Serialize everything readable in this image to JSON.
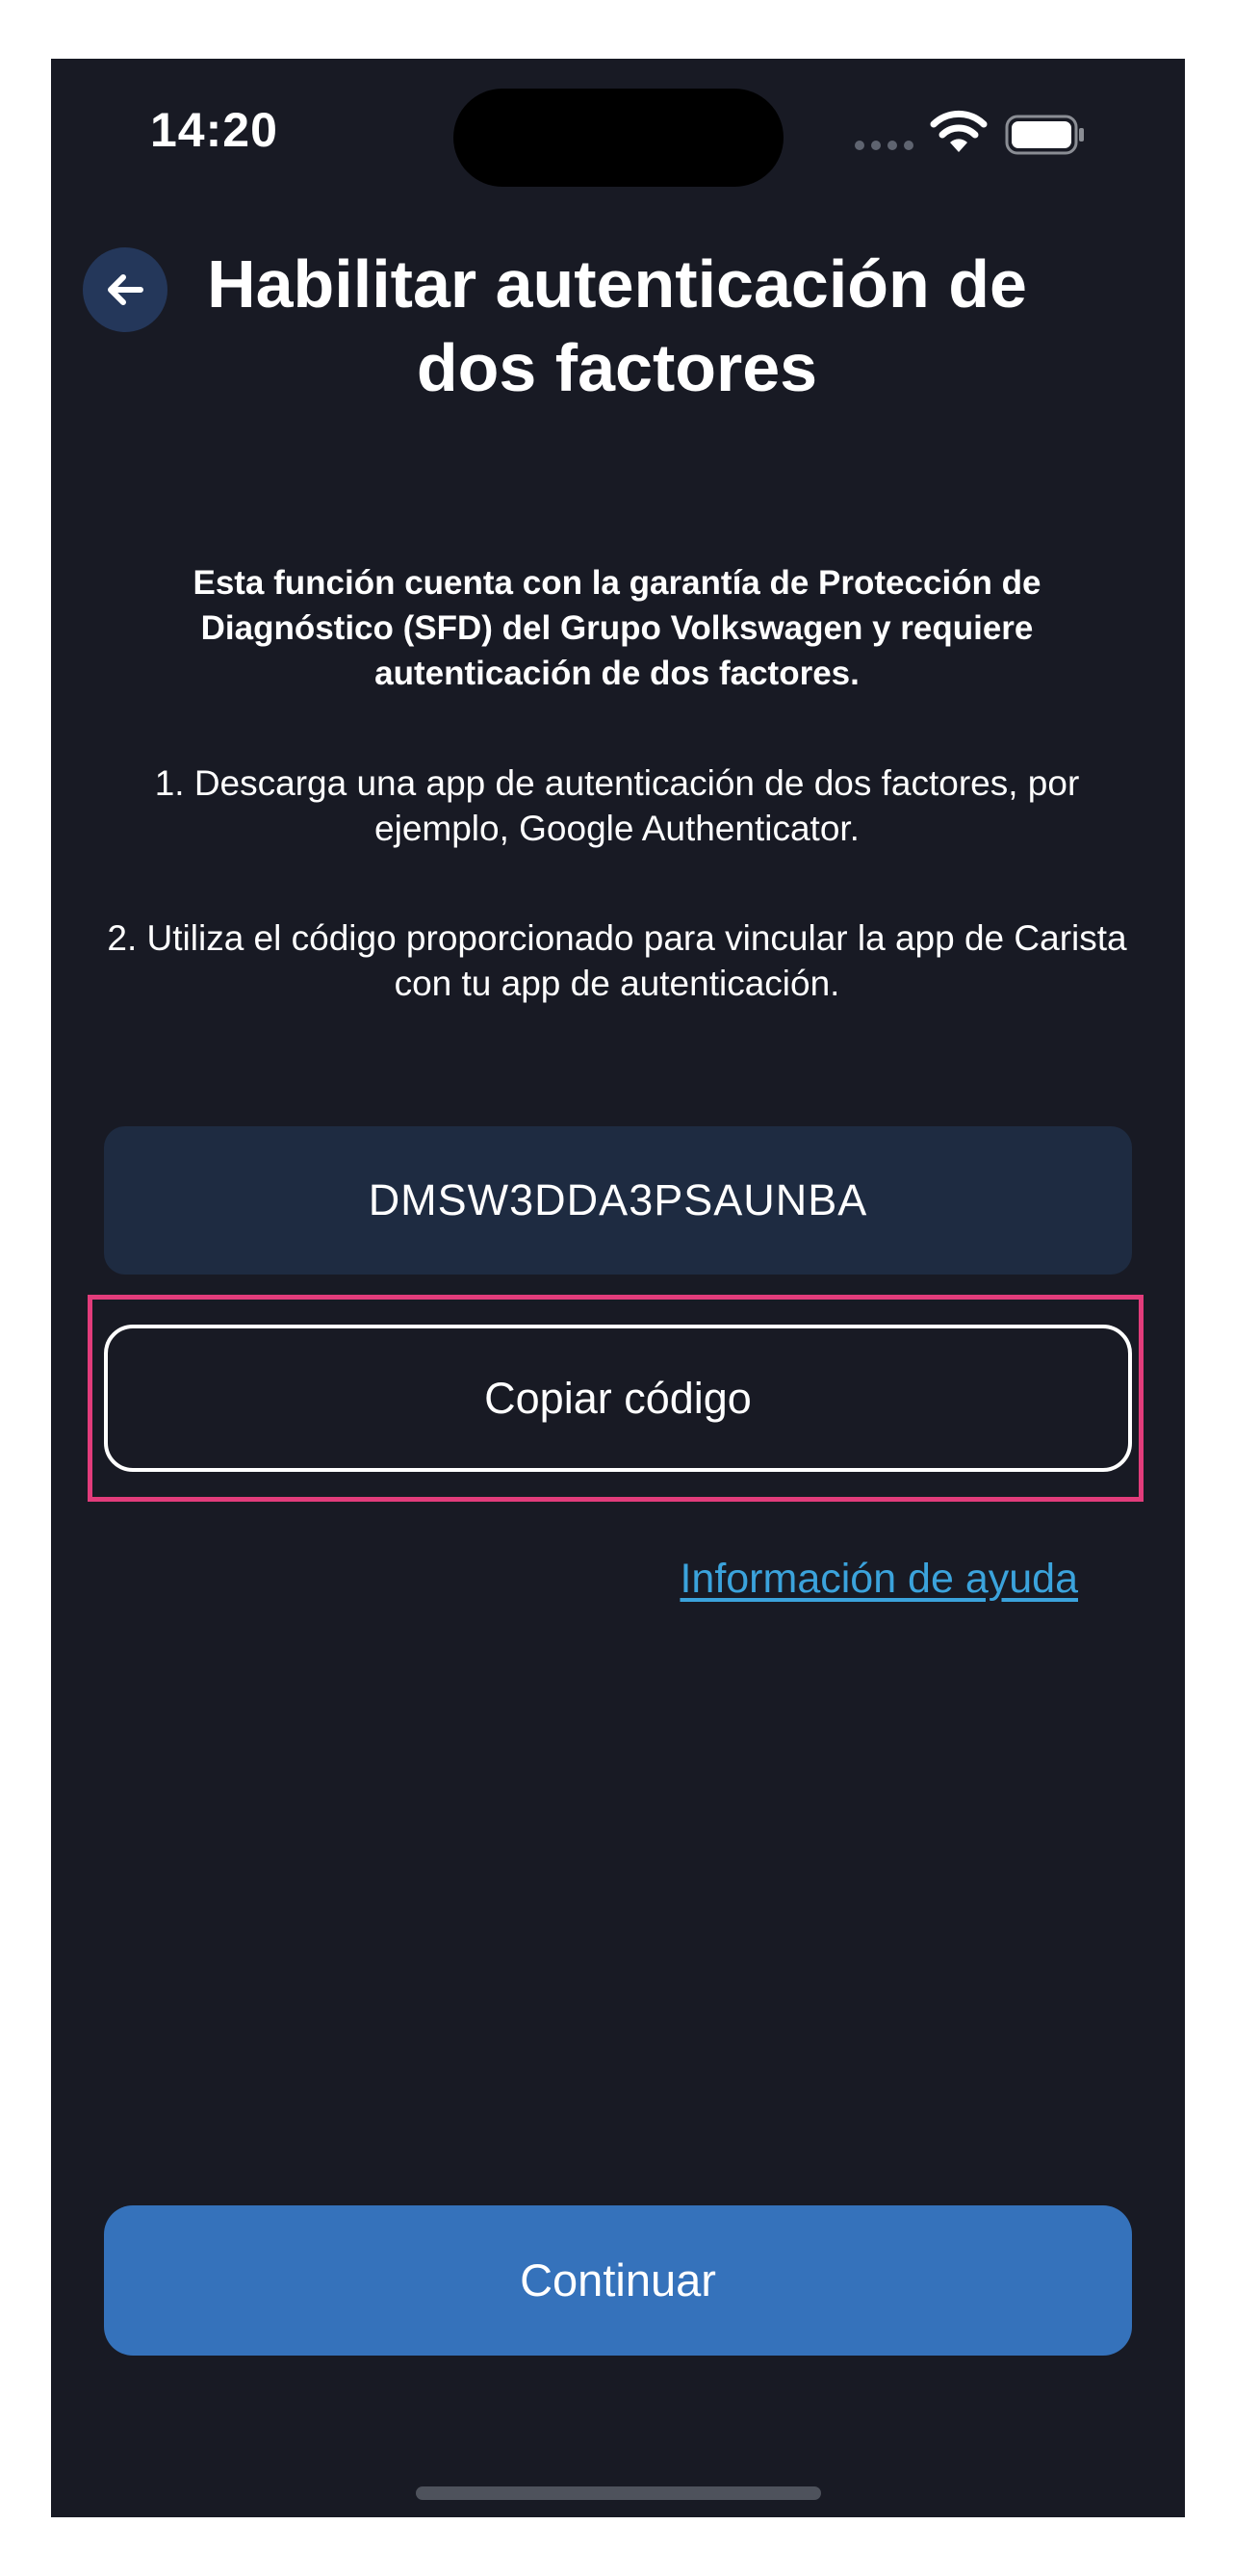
{
  "status_bar": {
    "time": "14:20"
  },
  "header": {
    "title": "Habilitar autenticación de dos factores"
  },
  "content": {
    "warning": "Esta función cuenta con la garantía de Protección de Diagnóstico (SFD) del Grupo Volkswagen y requiere autenticación de dos factores.",
    "step1": "1. Descarga una app de autenticación de dos factores, por ejemplo, Google Authenticator.",
    "step2": "2. Utiliza el código proporcionado para vincular la app de Carista con tu app de autenticación.",
    "code": "DMSW3DDA3PSAUNBA",
    "copy_label": "Copiar código",
    "help_link": "Información de ayuda"
  },
  "footer": {
    "continue_label": "Continuar"
  },
  "icons": {
    "back": "arrow-left-icon",
    "wifi": "wifi-icon",
    "battery": "battery-icon",
    "signal": "cellular-signal-icon"
  },
  "colors": {
    "background": "#181a24",
    "code_box": "#1e2b41",
    "primary_button": "#3572bb",
    "link": "#3ba3dc",
    "highlight": "#e23c7b"
  }
}
